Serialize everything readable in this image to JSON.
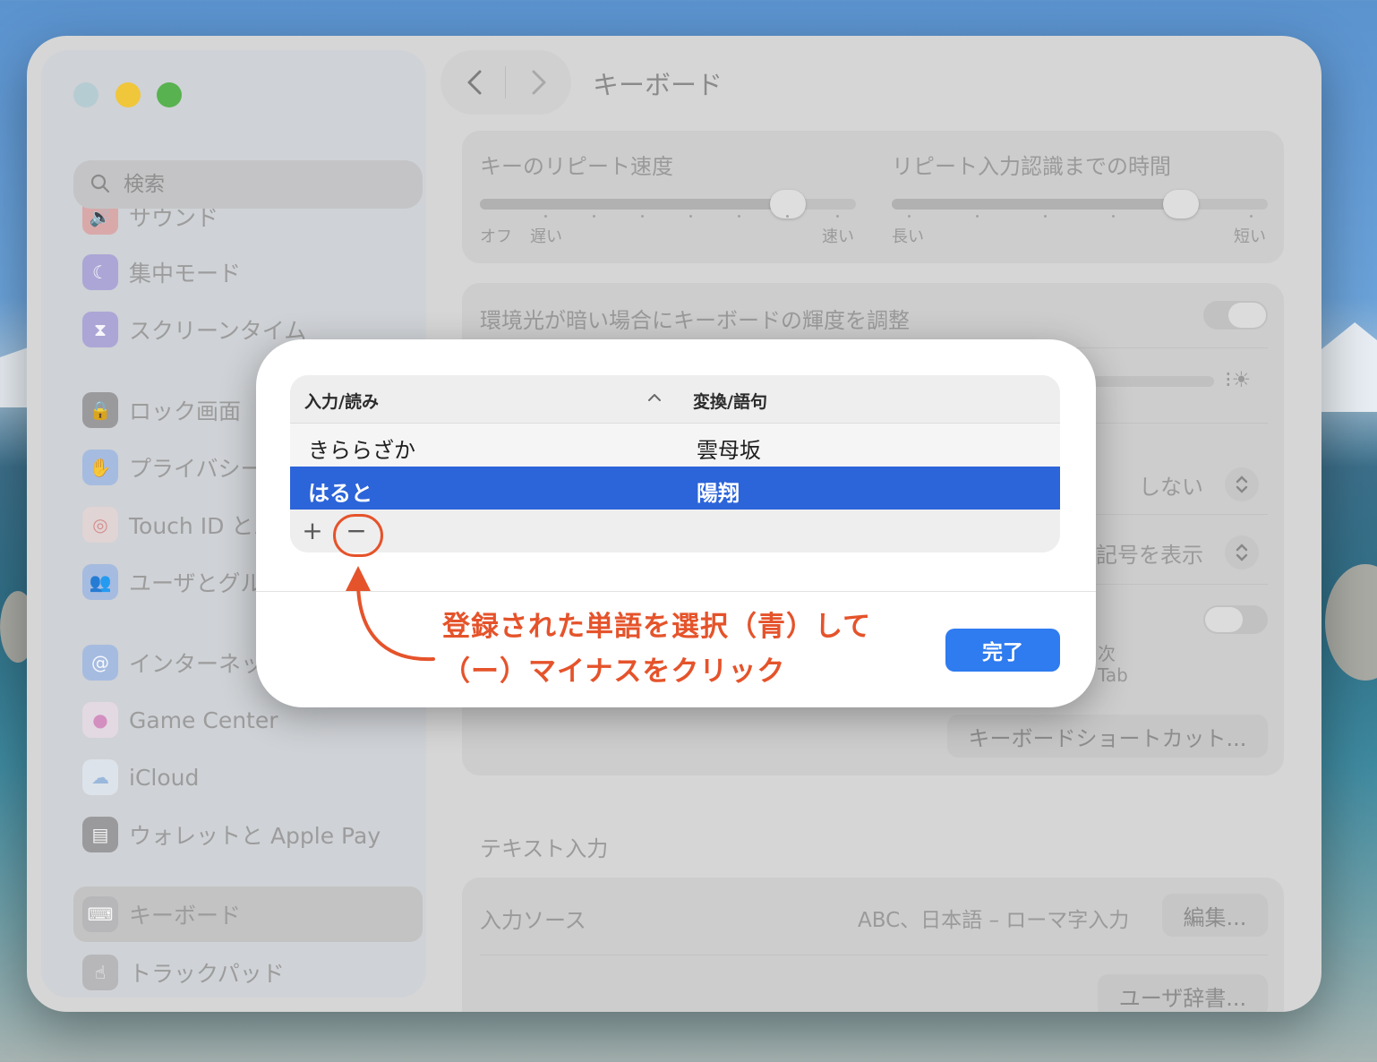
{
  "window": {
    "title": "キーボード"
  },
  "sidebar": {
    "search_placeholder": "検索",
    "items": [
      {
        "label": "サウンド",
        "icon": "speaker-icon",
        "color": "#e35a5a"
      },
      {
        "label": "集中モード",
        "icon": "moon-icon",
        "color": "#6b5fd6"
      },
      {
        "label": "スクリーンタイム",
        "icon": "hourglass-icon",
        "color": "#6b5fd6"
      },
      {
        "label": "ロック画面",
        "icon": "lock-icon",
        "color": "#2c2c2e"
      },
      {
        "label": "プライバシーと",
        "icon": "hand-icon",
        "color": "#3a7bea"
      },
      {
        "label": "Touch ID とパ",
        "icon": "fingerprint-icon",
        "color": "#ffffff"
      },
      {
        "label": "ユーザとグルー",
        "icon": "users-icon",
        "color": "#3a7bea"
      },
      {
        "label": "インターネット",
        "icon": "at-icon",
        "color": "#3a7bea"
      },
      {
        "label": "Game Center",
        "icon": "game-center-icon",
        "color": "#ffffff"
      },
      {
        "label": "iCloud",
        "icon": "cloud-icon",
        "color": "#ffffff"
      },
      {
        "label": "ウォレットと Apple Pay",
        "icon": "wallet-icon",
        "color": "#2c2c2e"
      },
      {
        "label": "キーボード",
        "icon": "keyboard-icon",
        "color": "#8e8e93"
      },
      {
        "label": "トラックパッド",
        "icon": "trackpad-icon",
        "color": "#8e8e93"
      }
    ]
  },
  "settings": {
    "key_repeat": {
      "label": "キーのリピート速度",
      "min_label": "オフ",
      "slow_label": "遅い",
      "max_label": "速い",
      "value": 0.82
    },
    "delay_until_repeat": {
      "label": "リピート入力認識までの時間",
      "min_label": "長い",
      "max_label": "短い",
      "value": 0.77
    },
    "backlight_label": "環境光が暗い場合にキーボードの輝度を調整",
    "popup_value_1": "しない",
    "popup_value_2": "記号を表示",
    "partial_text_1": "次",
    "partial_text_2": "Tab",
    "shortcuts_button": "キーボードショートカット...",
    "text_input_section": "テキスト入力",
    "input_sources_label": "入力ソース",
    "input_sources_value": "ABC、日本語 – ローマ字入力",
    "edit_button": "編集...",
    "user_dict_button": "ユーザ辞書..."
  },
  "dialog": {
    "columns": {
      "input": "入力/読み",
      "output": "変換/語句"
    },
    "rows": [
      {
        "input": "きららざか",
        "output": "雲母坂",
        "selected": false
      },
      {
        "input": "はると",
        "output": "陽翔",
        "selected": true
      }
    ],
    "add_label": "+",
    "remove_label": "−",
    "done_button": "完了"
  },
  "annotation": {
    "line1": "登録された単語を選択（青）して",
    "line2": "（ー）マイナスをクリック",
    "color": "#e5532b"
  }
}
